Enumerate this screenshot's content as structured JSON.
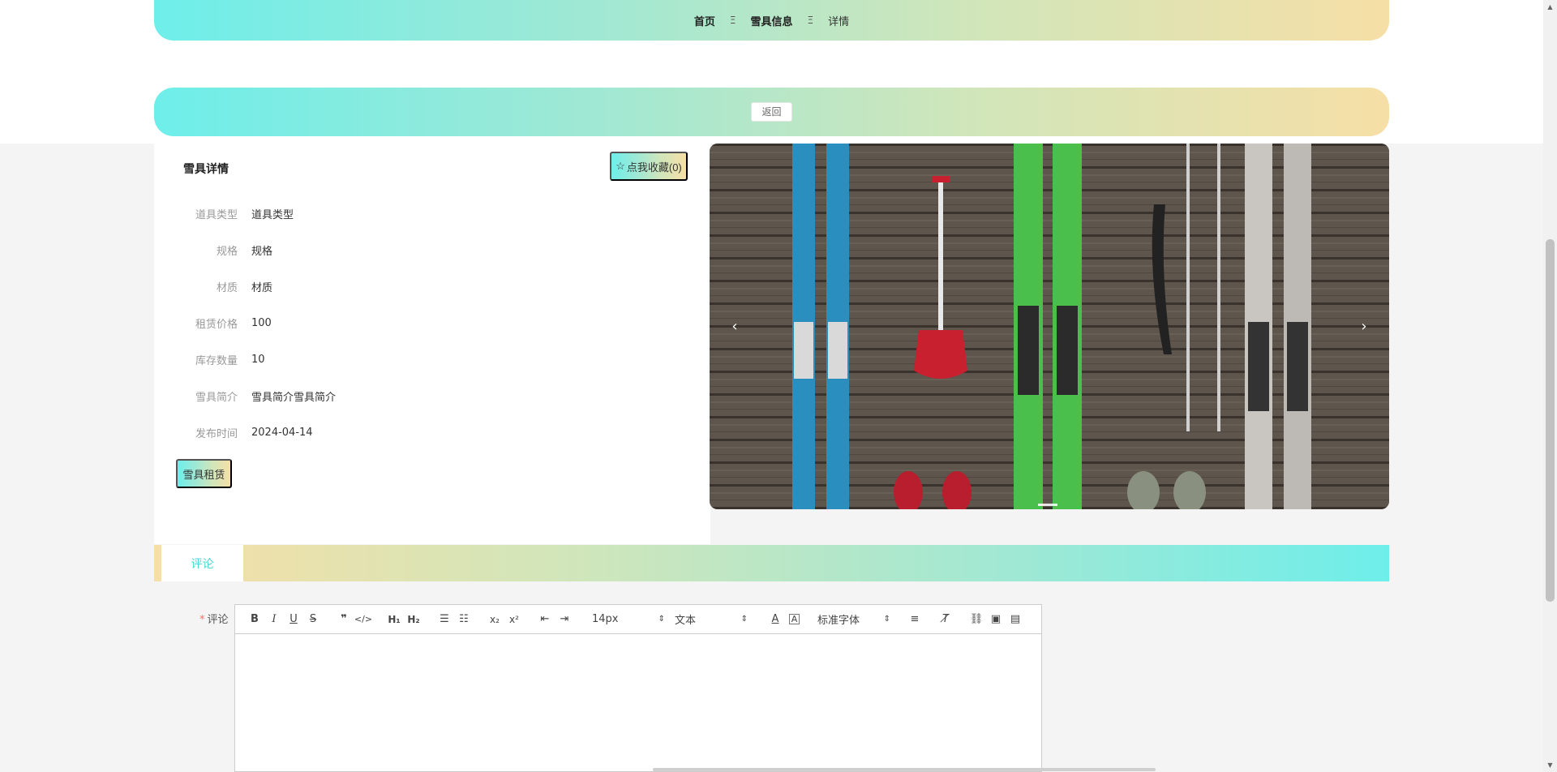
{
  "breadcrumb": {
    "items": [
      "首页",
      "雪具信息",
      "详情"
    ],
    "separator": "Ξ"
  },
  "back_button": "返回",
  "detail": {
    "title": "雪具详情",
    "favorite_button": "点我收藏(0)",
    "fields": [
      {
        "label": "道具类型",
        "value": "道具类型"
      },
      {
        "label": "规格",
        "value": "规格"
      },
      {
        "label": "材质",
        "value": "材质"
      },
      {
        "label": "租赁价格",
        "value": "100"
      },
      {
        "label": "库存数量",
        "value": "10"
      },
      {
        "label": "雪具简介",
        "value": "雪具简介雪具简介"
      },
      {
        "label": "发布时间",
        "value": "2024-04-14"
      }
    ],
    "rent_button": "雪具租赁"
  },
  "carousel": {
    "prev_glyph": "‹",
    "next_glyph": "›"
  },
  "tabs": [
    {
      "label": "评论",
      "active": true
    }
  ],
  "comment": {
    "required_mark": "*",
    "label": "评论",
    "toolbar": {
      "size_value": "14px",
      "header_value": "文本",
      "font_value": "标准字体"
    }
  },
  "colors": {
    "gradient_cyan": "#6eeeea",
    "gradient_yellow": "#f6dfa6",
    "active_tab_text": "#4cd7d2",
    "required": "#f56c6c"
  }
}
